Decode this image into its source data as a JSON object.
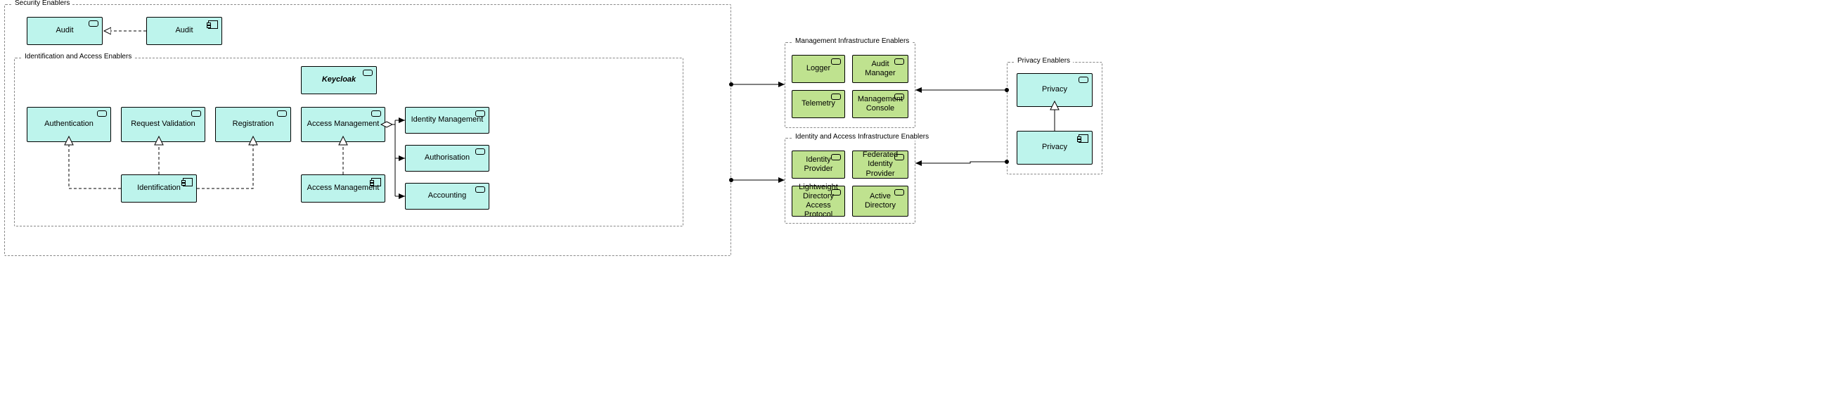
{
  "groups": {
    "security": "Security Enablers",
    "idaccess": "Identification and Access Enablers",
    "mgmt": "Management Infrastructure Enablers",
    "idinfra": "Identity and Access Infrastructure Enablers",
    "privacy": "Privacy Enablers"
  },
  "nodes": {
    "audit1": "Audit",
    "audit2": "Audit",
    "keycloak": "Keycloak",
    "auth": "Authentication",
    "reqval": "Request Validation",
    "reg": "Registration",
    "accessmgmt1": "Access Management",
    "idm": "Identity Management",
    "authz": "Authorisation",
    "acct": "Accounting",
    "identif": "Identification",
    "accessmgmt2": "Access Management",
    "logger": "Logger",
    "auditmgr": "Audit Manager",
    "telemetry": "Telemetry",
    "mgmtconsole": "Management Console",
    "idp": "Identity Provider",
    "fedidp": "Federated Identity Provider",
    "ldap": "Lightweight Directory Access Protocol",
    "ad": "Active Directory",
    "priv1": "Privacy",
    "priv2": "Privacy"
  }
}
